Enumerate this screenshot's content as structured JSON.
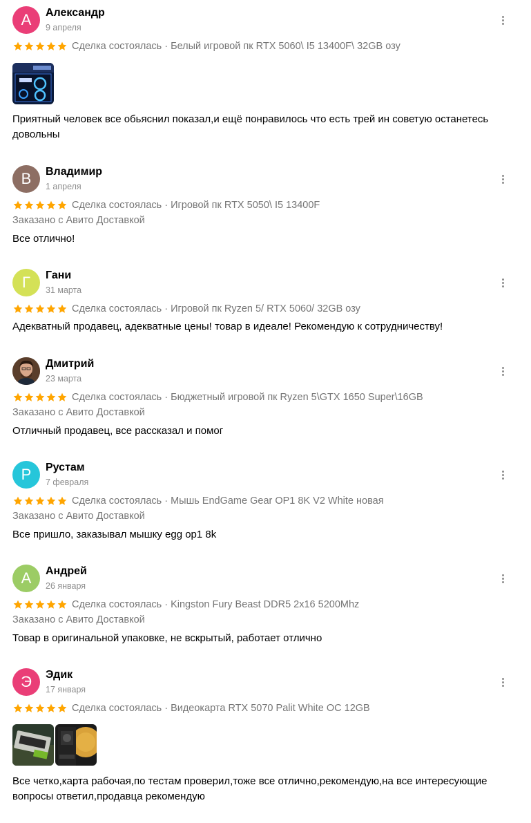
{
  "reviews": [
    {
      "avatar_letter": "А",
      "avatar_color": "#ea3e77",
      "name": "Александр",
      "date": "9 апреля",
      "rating": 5,
      "deal": "Сделка состоялась · Белый игровой пк RTX 5060\\ I5 13400F\\ 32GB озу",
      "text": "Приятный человек все обьяснил показал,и ещё понравилось что есть трей ин советую останетесь довольны",
      "photos": [
        "pc-photo"
      ]
    },
    {
      "avatar_letter": "В",
      "avatar_color": "#8d6e63",
      "name": "Владимир",
      "date": "1 апреля",
      "rating": 5,
      "deal": "Сделка состоялась · Игровой пк RTX 5050\\ I5 13400F",
      "delivery": "Заказано с Авито Доставкой",
      "text": "Все отлично!"
    },
    {
      "avatar_letter": "Г",
      "avatar_color": "#d4e157",
      "name": "Гани",
      "date": "31 марта",
      "rating": 5,
      "deal": "Сделка состоялась · Игровой пк Ryzen 5/ RTX 5060/ 32GB озу",
      "text": "Адекватный продавец, адекватные цены! товар в идеале! Рекомендую к сотрудничеству!"
    },
    {
      "avatar_letter": "",
      "avatar_color": "#6d4c36",
      "name": "Дмитрий",
      "date": "23 марта",
      "rating": 5,
      "deal": "Сделка состоялась · Бюджетный игровой пк Ryzen 5\\GTX 1650 Super\\16GB",
      "delivery": "Заказано с Авито Доставкой",
      "text": "Отличный продавец, все рассказал и помог"
    },
    {
      "avatar_letter": "Р",
      "avatar_color": "#26c6da",
      "name": "Рустам",
      "date": "7 февраля",
      "rating": 5,
      "deal": "Сделка состоялась · Мышь EndGame Gear OP1 8K V2 White новая",
      "delivery": "Заказано с Авито Доставкой",
      "text": "Все пришло, заказывал мышку egg op1 8k"
    },
    {
      "avatar_letter": "А",
      "avatar_color": "#9ccc65",
      "name": "Андрей",
      "date": "26 января",
      "rating": 5,
      "deal": "Сделка состоялась · Kingston Fury Beast DDR5 2x16 5200Mhz",
      "delivery": "Заказано с Авито Доставкой",
      "text": "Товар в оригинальной упаковке, не вскрытый, работает отлично"
    },
    {
      "avatar_letter": "Э",
      "avatar_color": "#ea3e77",
      "name": "Эдик",
      "date": "17 января",
      "rating": 5,
      "deal": "Сделка состоялась · Видеокарта RTX 5070 Palit White OC 12GB",
      "text": "Все четко,карта рабочая,по тестам проверил,тоже все отлично,рекомендую,на все интересующие вопросы ответил,продавца рекомендую",
      "photos": [
        "gpu-box-photo",
        "gpu-photo"
      ]
    }
  ],
  "colors": {
    "star": "#ffa500",
    "secondary_text": "#757575",
    "date_text": "#8d8d8d"
  }
}
